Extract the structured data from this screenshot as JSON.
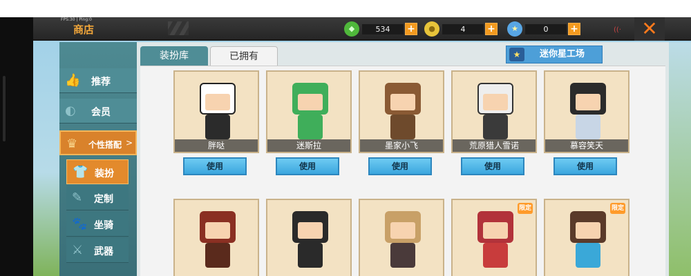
{
  "topbar": {
    "fps": "FPS:30 | Ping:0",
    "title": "商店",
    "currencies": [
      {
        "icon": "green-gem-icon",
        "value": "534",
        "color": "#4fb83b"
      },
      {
        "icon": "gold-coin-icon",
        "value": "4",
        "color": "#e7c43a"
      },
      {
        "icon": "blue-star-coin-icon",
        "value": "0",
        "color": "#58a6e4"
      }
    ],
    "plus": "+",
    "close": "✕"
  },
  "sidebar": {
    "items": [
      {
        "label": "推荐",
        "icon": "thumbs-up-icon"
      },
      {
        "label": "会员",
        "icon": "member-icon"
      },
      {
        "label": "个性搭配",
        "icon": "trophy-icon"
      },
      {
        "label": "装扮",
        "icon": "shirt-icon"
      },
      {
        "label": "定制",
        "icon": "brush-icon"
      },
      {
        "label": "坐骑",
        "icon": "paw-icon"
      },
      {
        "label": "武器",
        "icon": "gun-icon"
      }
    ],
    "expand_arrow": ">"
  },
  "tabs": {
    "dress": "装扮库",
    "owned": "已拥有",
    "workshop": "迷你星工场"
  },
  "cards_row1": [
    {
      "name": "胖哒",
      "button": "使用",
      "head": "#ffffff",
      "body": "#2b2b2b"
    },
    {
      "name": "迷斯拉",
      "button": "使用",
      "head": "#3fae5a",
      "body": "#3fae5a"
    },
    {
      "name": "墨家小飞",
      "button": "使用",
      "head": "#8a5a34",
      "body": "#6e4a2c"
    },
    {
      "name": "荒原猎人雪诺",
      "button": "使用",
      "head": "#eeeeee",
      "body": "#3a3a3a"
    },
    {
      "name": "慕容笑天",
      "button": "使用",
      "head": "#2b2b2b",
      "body": "#c8d6e6"
    }
  ],
  "cards_row2": [
    {
      "head": "#8a2f22",
      "body": "#5a2a1c",
      "badge": ""
    },
    {
      "head": "#2a2a2a",
      "body": "#2a2a2a",
      "badge": ""
    },
    {
      "head": "#c8a067",
      "body": "#4a3a3a",
      "badge": ""
    },
    {
      "head": "#b2323a",
      "body": "#c83c3c",
      "badge": "限定"
    },
    {
      "head": "#5a3a2a",
      "body": "#3aa8d8",
      "badge": "限定"
    }
  ]
}
